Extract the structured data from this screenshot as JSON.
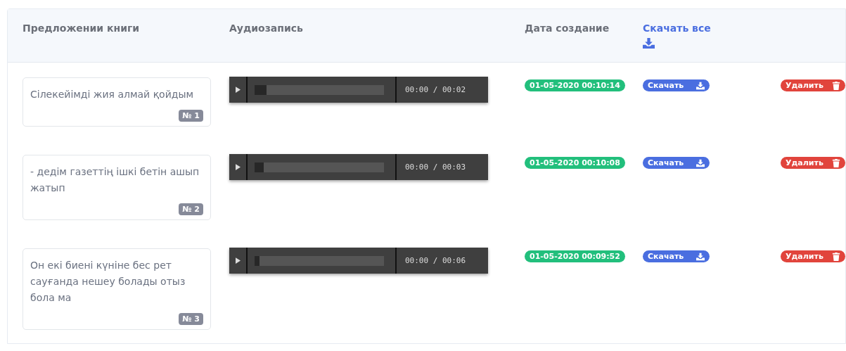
{
  "table": {
    "columns": [
      {
        "kind": "text",
        "label": "Предложении книги"
      },
      {
        "kind": "text",
        "label": "Аудиозапись"
      },
      {
        "kind": "text",
        "label": "Дата создание"
      },
      {
        "kind": "link",
        "label": "Скачать все"
      }
    ],
    "rows": [
      {
        "sentence": "Сілекейімді жия алмай қойдым",
        "number": "№ 1",
        "audio": {
          "time": "00:00 / 00:02",
          "level": 0.09
        },
        "date": "01-05-2020 00:10:14",
        "download": "Скачать",
        "delete": "Удалить"
      },
      {
        "sentence": "- дедім газеттің ішкі бетін ашып жатып",
        "number": "№ 2",
        "audio": {
          "time": "00:00 / 00:03",
          "level": 0.07
        },
        "date": "01-05-2020 00:10:08",
        "download": "Скачать",
        "delete": "Удалить"
      },
      {
        "sentence": "Он екі биені күніне бес рет сауғанда нешеу болады отыз бола ма",
        "number": "№ 3",
        "audio": {
          "time": "00:00 / 00:06",
          "level": 0.04
        },
        "date": "01-05-2020 00:09:52",
        "download": "Скачать",
        "delete": "Удалить"
      }
    ]
  }
}
